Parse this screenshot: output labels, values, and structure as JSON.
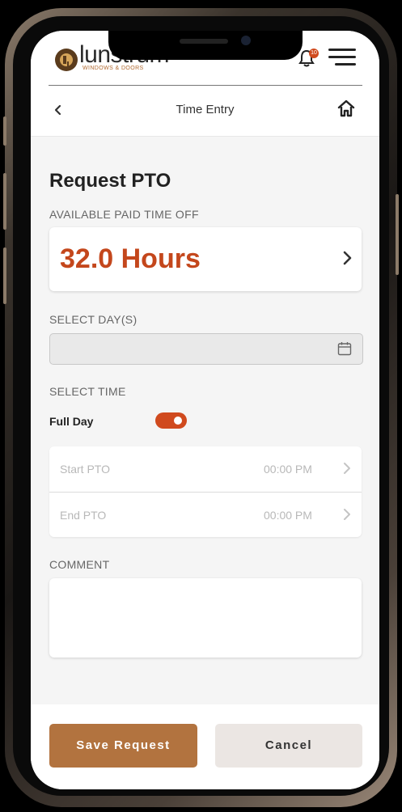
{
  "brand": {
    "logo_word": "lunstrum",
    "logo_sub": "WINDOWS & DOORS",
    "notification_count": "10"
  },
  "nav": {
    "title": "Time Entry"
  },
  "page": {
    "title": "Request PTO",
    "available_label": "AVAILABLE PAID TIME OFF",
    "available_value": "32.0 Hours",
    "select_days_label": "SELECT DAY(S)",
    "select_days_value": "",
    "select_time_label": "SELECT TIME",
    "full_day_label": "Full Day",
    "full_day_on": true,
    "start_label": "Start PTO",
    "start_value": "00:00 PM",
    "end_label": "End PTO",
    "end_value": "00:00 PM",
    "comment_label": "COMMENT",
    "comment_value": ""
  },
  "footer": {
    "save_label": "Save Request",
    "cancel_label": "Cancel"
  },
  "colors": {
    "accent": "#c4471c",
    "toggle_on": "#d04a1e",
    "save_button": "#b2733f",
    "cancel_button": "#ebe6e3"
  },
  "icons": {
    "back": "chevron-left-icon",
    "home": "home-icon",
    "bell": "bell-icon",
    "menu": "hamburger-menu-icon",
    "calendar": "calendar-icon",
    "chevron": "chevron-right-icon"
  }
}
